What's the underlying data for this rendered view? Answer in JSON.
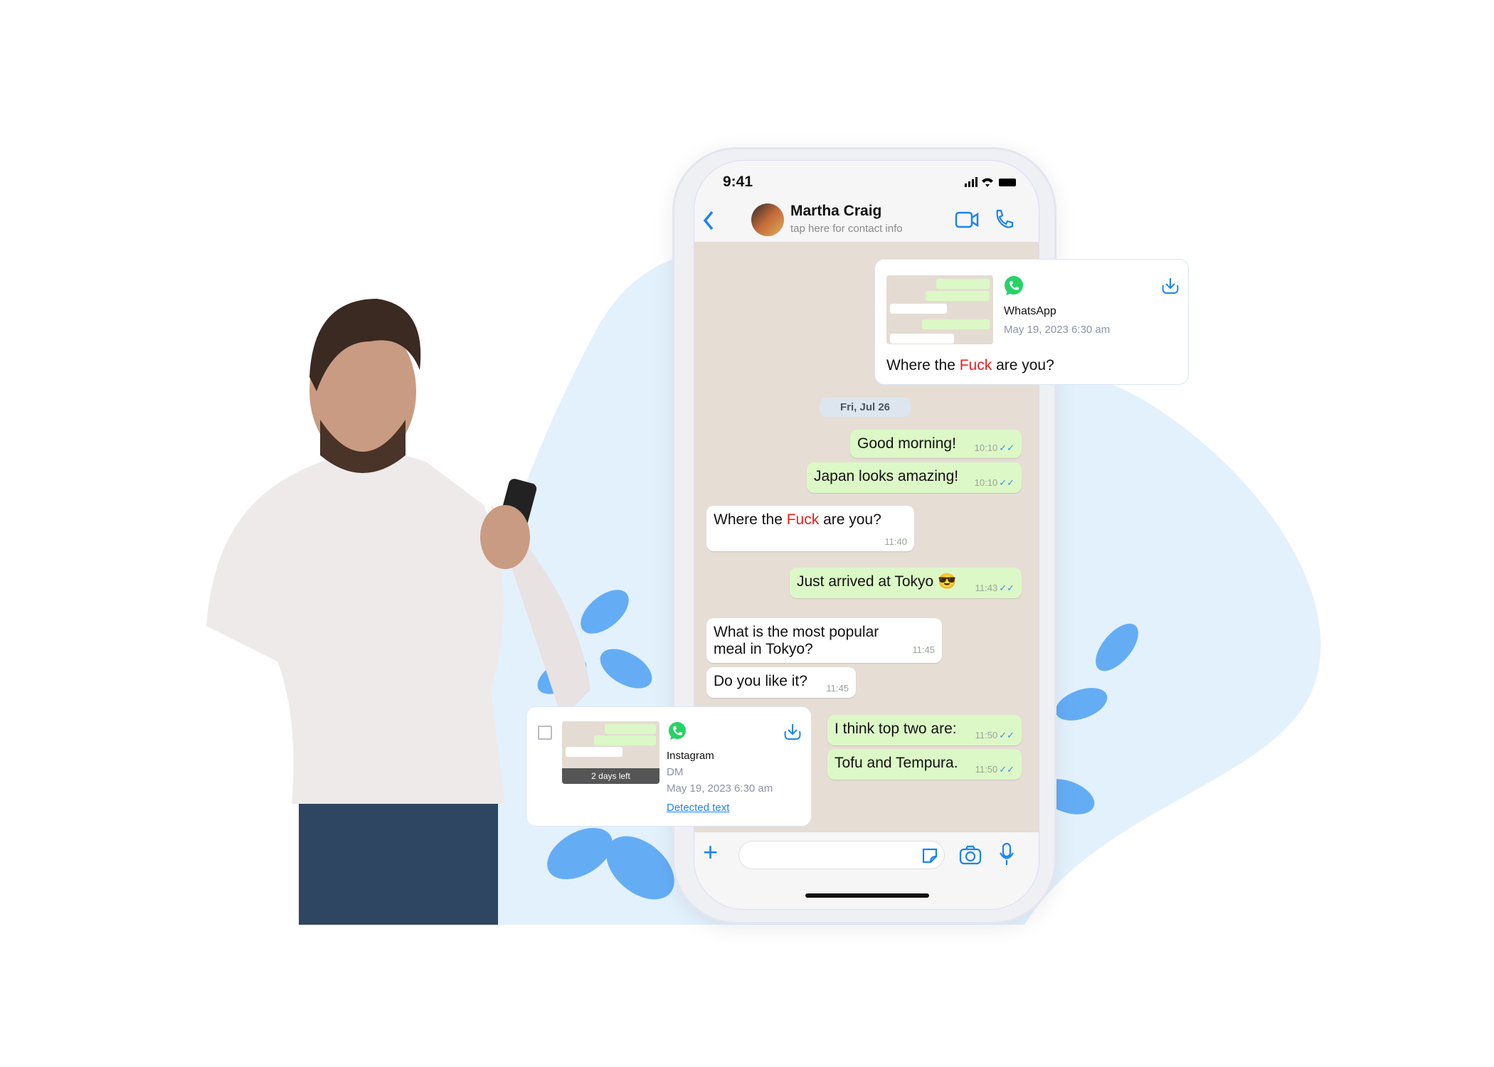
{
  "phone": {
    "time": "9:41",
    "contact": {
      "name": "Martha Craig",
      "subtitle": "tap here for contact info"
    },
    "date_pill": "Fri, Jul 26",
    "messages": [
      {
        "dir": "out",
        "text": "Good morning!",
        "time": "10:10"
      },
      {
        "dir": "out",
        "text": "Japan looks amazing!",
        "time": "10:10"
      },
      {
        "dir": "in",
        "pre": "Where the ",
        "flag": "Fuck",
        "post": " are you?",
        "time": "11:40"
      },
      {
        "dir": "out",
        "text": "Just arrived at Tokyo",
        "emoji": "😎",
        "time": "11:43"
      },
      {
        "dir": "in",
        "text": "What is the most popular meal in Tokyo?",
        "time": "11:45"
      },
      {
        "dir": "in",
        "text": "Do you like it?",
        "time": "11:45"
      },
      {
        "dir": "out",
        "text": "I think top two are:",
        "time": "11:50"
      },
      {
        "dir": "out",
        "text": "Tofu and Tempura.",
        "time": "11:50"
      }
    ]
  },
  "card_whatsapp": {
    "app": "WhatsApp",
    "date": "May 19, 2023 6:30 am",
    "pre": "Where the ",
    "flag": "Fuck",
    "post": " are you?"
  },
  "card_instagram": {
    "app": "Instagram",
    "type": "DM",
    "date": "May 19, 2023 6:30 am",
    "link": "Detected text",
    "badge": "2 days left"
  },
  "colors": {
    "accent": "#1a84f0",
    "flag": "#f21c1c",
    "bubble_out": "#dcf8c6",
    "whatsapp": "#25d366",
    "blob": "#e3f1fd",
    "leaf": "#64adf5"
  }
}
